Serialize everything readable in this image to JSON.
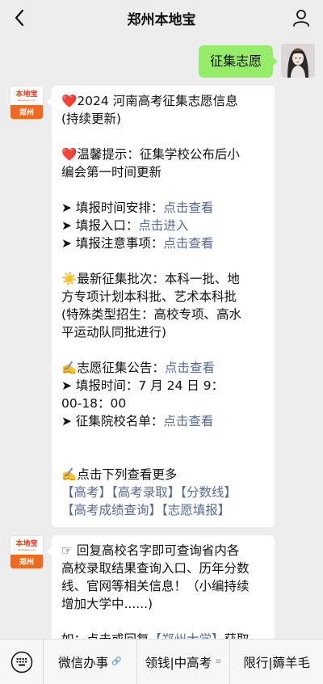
{
  "header": {
    "title": "郑州本地宝"
  },
  "avatars": {
    "brand_logo_text": "本地宝",
    "brand_logo_url": "Bendibao.com",
    "brand_city": "郑州"
  },
  "outgoing": {
    "text": "征集志愿"
  },
  "message1": {
    "l1": "2024 河南高考征集志愿信息",
    "l2": "(持续更新)",
    "l3": "温馨提示：征集学校公布后小",
    "l4": "编会第一时间更新",
    "time_label": "➤ 填报时间安排：",
    "time_link": "点击查看",
    "entry_label": "➤ 填报入口：",
    "entry_link": "点击进入",
    "notes_label": "➤ 填报注意事项：",
    "notes_link": "点击查看",
    "batch_l1": "最新征集批次：本科一批、地",
    "batch_l2": "方专项计划本科批、艺术本科批",
    "batch_l3": "(特殊类型招生：高校专项、高水",
    "batch_l4": "平运动队同批进行)",
    "notice_label": "志愿征集公告：",
    "notice_link": "点击查看",
    "fill_time_l1": "➤ 填报时间：7 月 24 日 9：",
    "fill_time_l2": "00-18：00",
    "schools_label": "➤ 征集院校名单：",
    "schools_link": "点击查看",
    "more_label": "点击下列查看更多",
    "tags_row1": [
      "【高考】",
      "【高考录取】",
      "【分数线】"
    ],
    "tags_row2": [
      "【高考成绩查询】",
      "【志愿填报】"
    ]
  },
  "message2": {
    "l1": "☞ 回复高校名字即可查询省内各",
    "l2": "高校录取结果查询入口、历年分数",
    "l3": "线、官网等相关信息！（小编持续",
    "l4": "增加大学中......)",
    "l5_prefix": "如：点击或回复",
    "l5_link": "【郑州大学】",
    "l5_suffix": "获取"
  },
  "bottombar": {
    "menus": [
      "微信办事",
      "领钱|中高考",
      "限行|薅羊毛"
    ]
  },
  "colors": {
    "bg": "#ededed",
    "bubble_out": "#95ec69",
    "link": "#576b95",
    "brand_orange": "#ef6a1f"
  }
}
